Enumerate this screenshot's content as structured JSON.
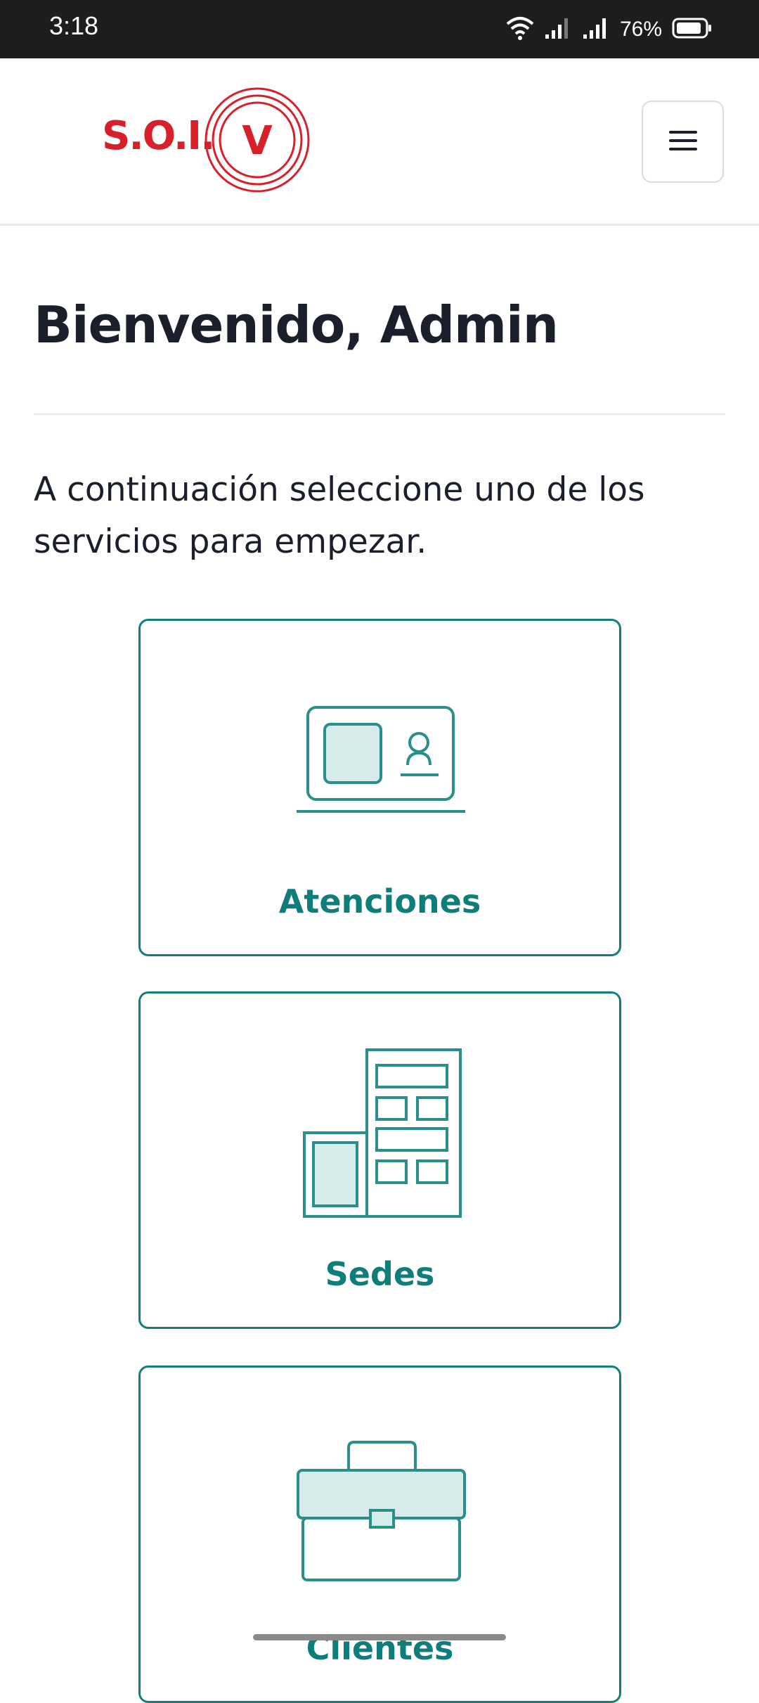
{
  "status_bar": {
    "time": "3:18",
    "battery": "76%",
    "icons": [
      "wifi-icon",
      "signal-icon",
      "signal-icon",
      "battery-icon"
    ]
  },
  "header": {
    "logo_text": "S.O.I.",
    "logo_letter": "V",
    "brand_color": "#d8202b",
    "menu_icon": "hamburger-icon"
  },
  "main": {
    "title": "Bienvenido, Admin",
    "intro": "A continuación seleccione uno de los servicios para empezar.",
    "accent_color": "#137f7c",
    "services": [
      {
        "label": "Atenciones",
        "icon": "id-card-icon"
      },
      {
        "label": "Sedes",
        "icon": "buildings-icon"
      },
      {
        "label": "Clientes",
        "icon": "briefcase-icon"
      }
    ]
  }
}
